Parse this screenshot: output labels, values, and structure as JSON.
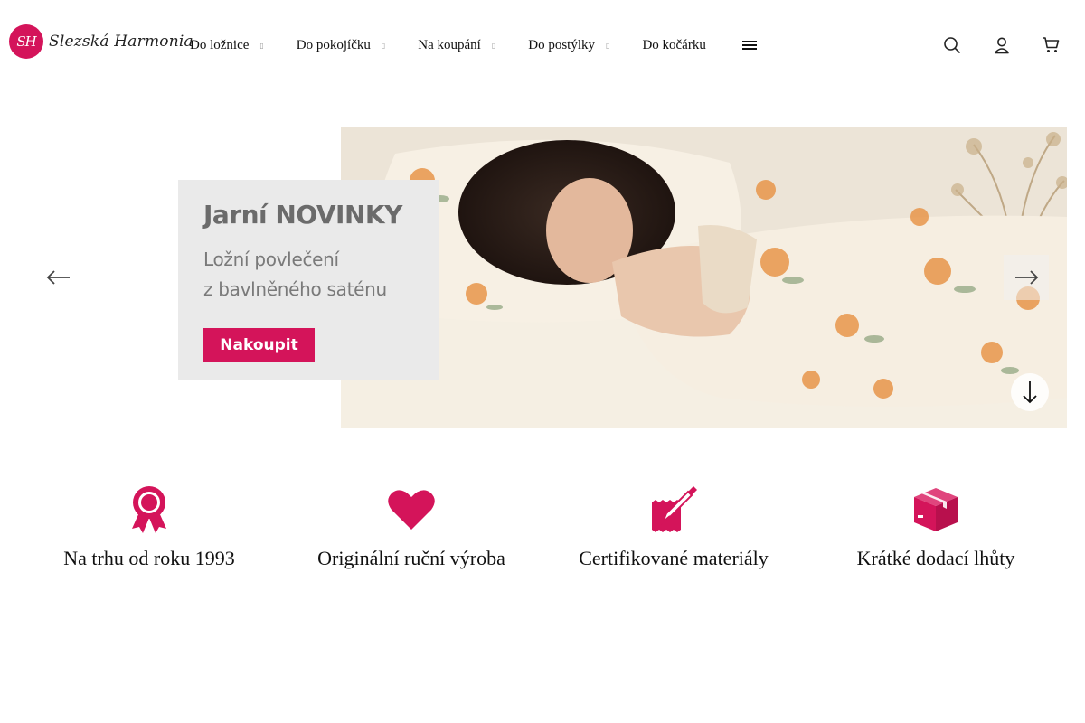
{
  "brand": {
    "badge": "SH",
    "name": "Slezská Harmonia",
    "accent_color": "#d4145a"
  },
  "nav": {
    "items": [
      {
        "label": "Do ložnice",
        "has_dropdown": true,
        "caret": "▯"
      },
      {
        "label": "Do pokojíčku",
        "has_dropdown": true,
        "caret": "▯"
      },
      {
        "label": "Na koupání",
        "has_dropdown": true,
        "caret": "▯"
      },
      {
        "label": "Do postýlky",
        "has_dropdown": true,
        "caret": "▯"
      },
      {
        "label": "Do kočárku",
        "has_dropdown": false
      }
    ],
    "more_icon": "hamburger-icon"
  },
  "header_icons": [
    "search-icon",
    "user-icon",
    "cart-icon"
  ],
  "hero": {
    "title": "Jarní NOVINKY",
    "subtitle": "Ložní povlečení\nz bavlněného saténu",
    "cta_label": "Nakoupit",
    "prev_icon": "arrow-left-icon",
    "next_icon": "arrow-right-icon",
    "scroll_icon": "arrow-down-icon"
  },
  "features": [
    {
      "icon": "award-ribbon-icon",
      "label": "Na trhu od roku 1993"
    },
    {
      "icon": "heart-icon",
      "label": "Originální ruční výroba"
    },
    {
      "icon": "certificate-pen-icon",
      "label": "Certifikované materiály"
    },
    {
      "icon": "package-box-icon",
      "label": "Krátké dodací lhůty"
    }
  ]
}
